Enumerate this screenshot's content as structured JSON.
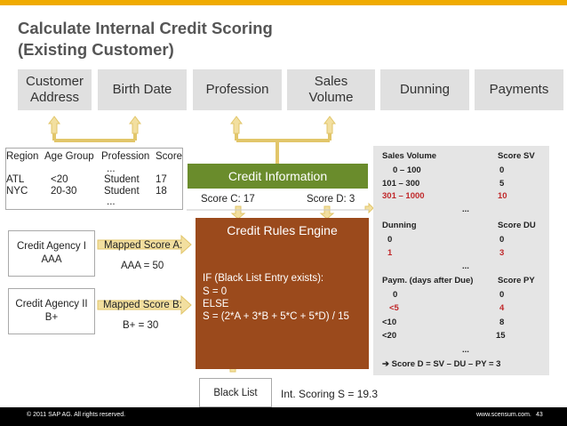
{
  "title": {
    "line1": "Calculate Internal Credit Scoring",
    "line2": "(Existing Customer)"
  },
  "headers": {
    "customer_address_1": "Customer",
    "customer_address_2": "Address",
    "birth_date": "Birth Date",
    "profession": "Profession",
    "sales_volume_1": "Sales",
    "sales_volume_2": "Volume",
    "dunning": "Dunning",
    "payments": "Payments"
  },
  "region_table": {
    "columns": [
      "Region",
      "Age Group",
      "Profession",
      "Score"
    ],
    "ellipsis_top": "...",
    "rows": [
      [
        "ATL",
        "<20",
        "Student",
        "17"
      ],
      [
        "NYC",
        "20-30",
        "Student",
        "18"
      ]
    ],
    "ellipsis_bottom": "..."
  },
  "credit_information": "Credit Information",
  "score_c": "Score C: 17",
  "score_d": "Score D: 3",
  "engine": {
    "title": "Credit Rules Engine",
    "rules": [
      "IF (Black List Entry exists):",
      "S = 0",
      "ELSE",
      "S = (2*A + 3*B + 5*C + 5*D) / 15"
    ]
  },
  "agency1": {
    "line1": "Credit Agency I",
    "line2": "AAA"
  },
  "agency2": {
    "line1": "Credit Agency II",
    "line2": "B+"
  },
  "mapped_a": {
    "label": "Mapped Score A:",
    "value": "AAA = 50"
  },
  "mapped_b": {
    "label": "Mapped Score B:",
    "value": "B+ = 30"
  },
  "right_panel": {
    "sales_header": "Sales Volume",
    "sales_score_header": "Score SV",
    "sales_rows": [
      {
        "range": "0 –   100",
        "score": "0",
        "highlight": false
      },
      {
        "range": "101 –   300",
        "score": "5",
        "highlight": false
      },
      {
        "range": "301 – 1000",
        "score": "10",
        "highlight": true
      }
    ],
    "ellipsis1": "...",
    "dunning_header": "Dunning",
    "dunning_score_header": "Score DU",
    "dunning_rows": [
      {
        "range": "0",
        "score": "0",
        "highlight": false
      },
      {
        "range": "1",
        "score": "3",
        "highlight": true
      }
    ],
    "ellipsis2": "...",
    "paym_header": "Paym. (days after Due)",
    "paym_score_header": "Score PY",
    "paym_rows": [
      {
        "range": "0",
        "score": "0",
        "highlight": false
      },
      {
        "range": "<5",
        "score": "4",
        "highlight": true
      },
      {
        "range": "<10",
        "score": "8",
        "highlight": false
      },
      {
        "range": "<20",
        "score": "15",
        "highlight": false
      }
    ],
    "ellipsis3": "...",
    "formula": "Score D = SV – DU – PY = 3",
    "arrow_glyph": "➔"
  },
  "black_list": "Black List",
  "int_scoring": "Int. Scoring S = 19.3",
  "footer": {
    "copyright": "© 2011 SAP AG. All rights reserved.",
    "site": "www.scensum.com.",
    "page": "43"
  },
  "colors": {
    "accent_bar": "#f0ab00",
    "credit_info_green": "#6a8c2c",
    "engine_brown": "#9b4a1c",
    "arrow_yellow": "#f2dfa0",
    "highlight_red": "#c0282a"
  }
}
